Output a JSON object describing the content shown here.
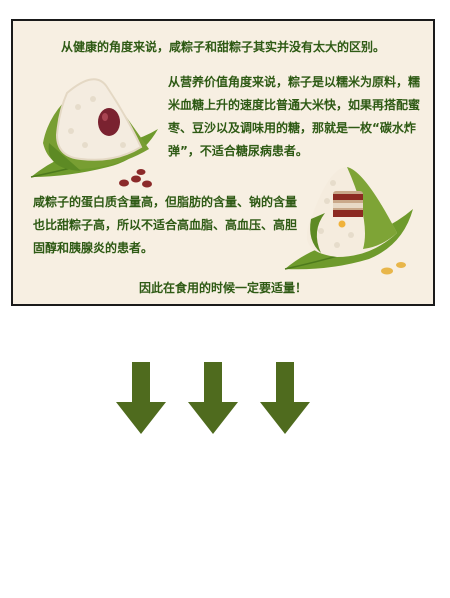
{
  "card": {
    "title": "从健康的角度来说，咸粽子和甜粽子其实并没有太大的区别。",
    "paragraph_sweet": "从营养价值角度来说，粽子是以糯米为原料，糯米血糖上升的速度比普通大米快，如果再搭配蜜枣、豆沙以及调味用的糖，那就是一枚“碳水炸弹”，不适合糖尿病患者。",
    "paragraph_salty": "咸粽子的蛋白质含量高，但脂肪的含量、钠的含量也比甜粽子高，所以不适合高血脂、高血压、高胆固醇和胰腺炎的患者。",
    "footer": "因此在食用的时候一定要适量！"
  },
  "illustrations": {
    "sweet_zongzi": "zongzi-red-bean-icon",
    "salty_zongzi": "zongzi-pork-icon",
    "arrows": "down-arrow-icon"
  },
  "colors": {
    "background": "#ffffff",
    "card_background": "#f7efe2",
    "text_green": "#2e5a14",
    "arrow_green": "#4f6b1e",
    "border": "#1a1a1a"
  }
}
